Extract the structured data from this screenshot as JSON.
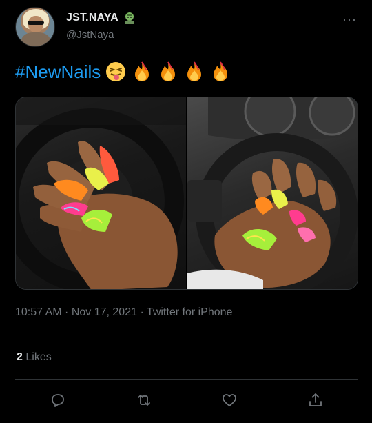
{
  "user": {
    "display_name": "JST.NAYA",
    "handle": "@JstNaya",
    "name_emoji": "zombie-emoji"
  },
  "tweet": {
    "hashtag": "#NewNails",
    "emojis": [
      "squinting-tongue-face-emoji",
      "fire-emoji",
      "fire-emoji",
      "fire-emoji",
      "fire-emoji"
    ],
    "media": [
      {
        "description_icon": "photo-left-hand-flame-nails"
      },
      {
        "description_icon": "photo-right-hand-flame-nails"
      }
    ],
    "timestamp": "10:57 AM · Nov 17, 2021 · Twitter for iPhone",
    "likes_count": "2",
    "likes_label": "Likes"
  },
  "actions": [
    {
      "name": "reply",
      "icon": "reply-icon"
    },
    {
      "name": "retweet",
      "icon": "retweet-icon"
    },
    {
      "name": "like",
      "icon": "heart-icon"
    },
    {
      "name": "share",
      "icon": "share-icon"
    }
  ],
  "colors": {
    "background": "#000000",
    "text_primary": "#e7e9ea",
    "text_secondary": "#71767b",
    "accent": "#1d9bf0",
    "divider": "#2f3336"
  }
}
